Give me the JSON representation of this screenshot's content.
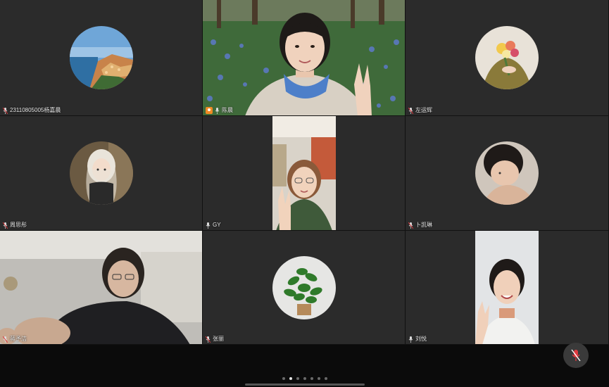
{
  "participants": [
    {
      "name": "23110805005杨嘉晨",
      "type": "avatar",
      "icon": "landscape-avatar-icon"
    },
    {
      "name": "陈晨",
      "type": "video",
      "host": true,
      "icon": "host-icon"
    },
    {
      "name": "左运辉",
      "type": "avatar",
      "icon": "bouquet-avatar-icon"
    },
    {
      "name": "周思彤",
      "type": "avatar",
      "icon": "anime-girl-avatar-icon"
    },
    {
      "name": "GY",
      "type": "video"
    },
    {
      "name": "卜凯琳",
      "type": "avatar",
      "icon": "person-photo-avatar-icon"
    },
    {
      "name": "蒋予洁",
      "type": "video"
    },
    {
      "name": "张丽",
      "type": "avatar",
      "icon": "plant-avatar-icon"
    },
    {
      "name": "刘悦",
      "type": "video"
    }
  ],
  "pager": {
    "count": 7,
    "active_index": 1
  },
  "controls": {
    "mute_icon": "microphone-muted-icon"
  },
  "colors": {
    "tile_bg": "#2b2b2b",
    "host_badge": "#f08a24",
    "mute_red": "#e0393e"
  }
}
